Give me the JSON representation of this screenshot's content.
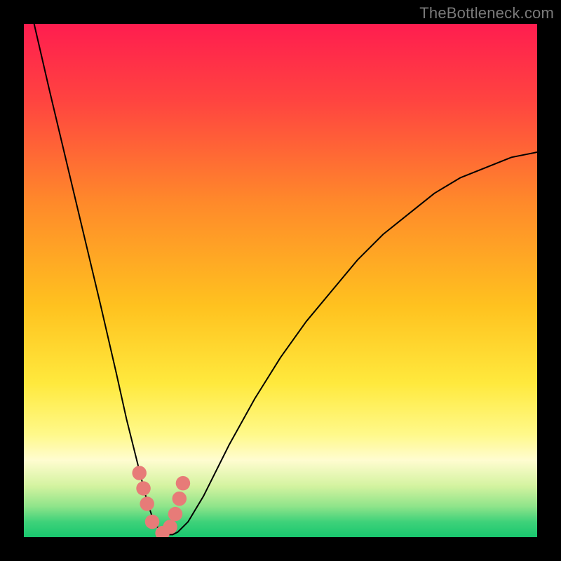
{
  "watermark": "TheBottleneck.com",
  "chart_data": {
    "type": "line",
    "title": "",
    "xlabel": "",
    "ylabel": "",
    "xlim": [
      0,
      100
    ],
    "ylim": [
      0,
      100
    ],
    "curve": {
      "x": [
        2,
        5,
        10,
        15,
        18,
        20,
        22,
        23,
        24,
        25,
        26,
        27,
        28,
        29,
        30,
        32,
        35,
        40,
        45,
        50,
        55,
        60,
        65,
        70,
        75,
        80,
        85,
        90,
        95,
        100
      ],
      "y": [
        100,
        87,
        66,
        45,
        32,
        23,
        15,
        11,
        7,
        4,
        2,
        1,
        0.5,
        0.5,
        1,
        3,
        8,
        18,
        27,
        35,
        42,
        48,
        54,
        59,
        63,
        67,
        70,
        72,
        74,
        75
      ]
    },
    "markers": {
      "x": [
        22.5,
        23.3,
        24.0,
        25.0,
        27.0,
        28.5,
        29.5,
        30.3,
        31.0
      ],
      "y": [
        12.5,
        9.5,
        6.5,
        3.0,
        0.8,
        2.0,
        4.5,
        7.5,
        10.5
      ]
    },
    "gradient_stops": [
      {
        "pct": 0,
        "color": "#ff1d4f"
      },
      {
        "pct": 15,
        "color": "#ff4440"
      },
      {
        "pct": 35,
        "color": "#ff8a2a"
      },
      {
        "pct": 55,
        "color": "#ffc21f"
      },
      {
        "pct": 70,
        "color": "#ffe93d"
      },
      {
        "pct": 80,
        "color": "#fff98a"
      },
      {
        "pct": 85,
        "color": "#fffcd0"
      },
      {
        "pct": 90,
        "color": "#d4f3a0"
      },
      {
        "pct": 94,
        "color": "#8fe48a"
      },
      {
        "pct": 97,
        "color": "#3fd27a"
      },
      {
        "pct": 100,
        "color": "#18c76e"
      }
    ],
    "marker_color": "#e77b78",
    "curve_color": "#000000"
  }
}
